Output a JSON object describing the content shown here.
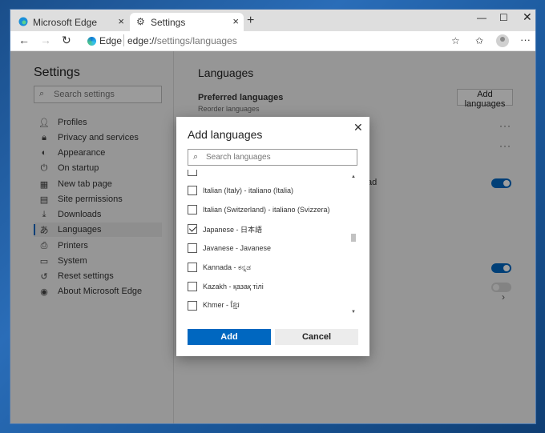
{
  "tabs": [
    {
      "label": "Microsoft Edge",
      "icon": "edge-icon"
    },
    {
      "label": "Settings",
      "icon": "gear-icon"
    }
  ],
  "address": {
    "site_label": "Edge",
    "url_host": "edge://",
    "url_path": "settings/languages"
  },
  "sidebar": {
    "title": "Settings",
    "search_placeholder": "Search settings",
    "items": [
      {
        "label": "Profiles",
        "icon": "person-icon"
      },
      {
        "label": "Privacy and services",
        "icon": "lock-icon"
      },
      {
        "label": "Appearance",
        "icon": "palette-icon"
      },
      {
        "label": "On startup",
        "icon": "power-icon"
      },
      {
        "label": "New tab page",
        "icon": "newtab-icon"
      },
      {
        "label": "Site permissions",
        "icon": "grid-icon"
      },
      {
        "label": "Downloads",
        "icon": "download-icon"
      },
      {
        "label": "Languages",
        "icon": "language-icon",
        "active": true
      },
      {
        "label": "Printers",
        "icon": "printer-icon"
      },
      {
        "label": "System",
        "icon": "system-icon"
      },
      {
        "label": "Reset settings",
        "icon": "reset-icon"
      },
      {
        "label": "About Microsoft Edge",
        "icon": "edge-icon"
      }
    ]
  },
  "main": {
    "title": "Languages",
    "preferred_title": "Preferred languages",
    "preferred_sub": "Reorder languages",
    "add_button": "Add languages",
    "partial_text": "ad"
  },
  "dialog": {
    "title": "Add languages",
    "search_placeholder": "Search languages",
    "languages": [
      {
        "label": "",
        "checked": false
      },
      {
        "label": "Italian (Italy) - italiano (Italia)",
        "checked": false
      },
      {
        "label": "Italian (Switzerland) - italiano (Svizzera)",
        "checked": false
      },
      {
        "label": "Japanese - 日本語",
        "checked": true
      },
      {
        "label": "Javanese - Javanese",
        "checked": false
      },
      {
        "label": "Kannada - ಕನ್ನಡ",
        "checked": false
      },
      {
        "label": "Kazakh - қазақ тілі",
        "checked": false
      },
      {
        "label": "Khmer - ខ្មែរ",
        "checked": false
      }
    ],
    "add_label": "Add",
    "cancel_label": "Cancel"
  },
  "colors": {
    "accent": "#0067c0"
  }
}
